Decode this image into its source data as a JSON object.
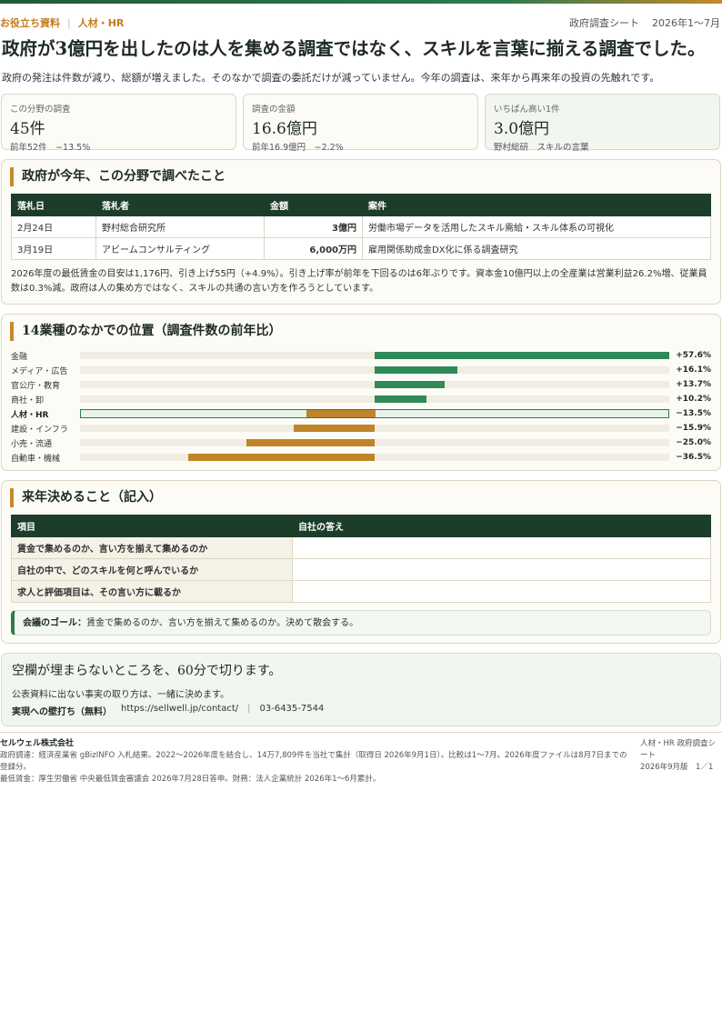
{
  "header": {
    "tag1": "お役立ち資料",
    "tag_sep": "|",
    "tag2": "人材・HR",
    "sheet_type": "政府調査シート",
    "period": "2026年1〜7月"
  },
  "headline": "政府が3億円を出したのは人を集める調査ではなく、スキルを言葉に揃える調査でした。",
  "lede": "政府の発注は件数が減り、総額が増えました。そのなかで調査の委託だけが減っていません。今年の調査は、来年から再来年の投資の先触れです。",
  "kpis": [
    {
      "label": "この分野の調査",
      "value": "45件",
      "sub": "前年52件　−13.5%"
    },
    {
      "label": "調査の金額",
      "value": "16.6億円",
      "sub": "前年16.9億円　−2.2%"
    },
    {
      "label": "いちばん高い1件",
      "value": "3.0億円",
      "sub": "野村総研　スキルの言葉"
    }
  ],
  "contracts": {
    "title": "政府が今年、この分野で調べたこと",
    "columns": [
      "落札日",
      "落札者",
      "金額",
      "案件"
    ],
    "rows": [
      {
        "date": "2月24日",
        "winner": "野村総合研究所",
        "amount": "3億円",
        "subject": "労働市場データを活用したスキル需給・スキル体系の可視化"
      },
      {
        "date": "3月19日",
        "winner": "アビームコンサルティング",
        "amount": "6,000万円",
        "subject": "雇用関係助成金DX化に係る調査研究"
      }
    ],
    "note": "2026年度の最低賃金の目安は1,176円、引き上げ55円（+4.9%）。引き上げ率が前年を下回るのは6年ぶりです。資本金10億円以上の全産業は営業利益26.2%増、従業員数は0.3%減。政府は人の集め方ではなく、スキルの共通の言い方を作ろうとしています。"
  },
  "chart_data": {
    "type": "bar",
    "title": "14業種のなかでの位置（調査件数の前年比）",
    "orientation": "horizontal",
    "categories": [
      "金融",
      "メディア・広告",
      "官公庁・教育",
      "商社・卸",
      "人材・HR",
      "建設・インフラ",
      "小売・流通",
      "自動車・機械"
    ],
    "values": [
      57.6,
      16.1,
      13.7,
      10.2,
      -13.5,
      -15.9,
      -25.0,
      -36.5
    ],
    "value_labels": [
      "+57.6%",
      "+16.1%",
      "+13.7%",
      "+10.2%",
      "−13.5%",
      "−15.9%",
      "−25.0%",
      "−36.5%"
    ],
    "highlight": "人材・HR",
    "colors": {
      "positive": "#2f8a58",
      "negative": "#c0842a"
    },
    "xlim": [
      -57.6,
      57.6
    ]
  },
  "decisions": {
    "title": "来年決めること（記入）",
    "columns": [
      "項目",
      "自社の答え"
    ],
    "rows": [
      {
        "item": "賃金で集めるのか、言い方を揃えて集めるのか",
        "answer": ""
      },
      {
        "item": "自社の中で、どのスキルを何と呼んでいるか",
        "answer": ""
      },
      {
        "item": "求人と評価項目は、その言い方に載るか",
        "answer": ""
      }
    ],
    "goal_label": "会議のゴール：",
    "goal_text": "賃金で集めるのか、言い方を揃えて集めるのか。決めて散会する。"
  },
  "cta": {
    "title": "空欄が埋まらないところを、60分で切ります。",
    "text": "公表資料に出ない事実の取り方は、一緒に決めます。",
    "link_label": "実現への壁打ち（無料）",
    "url": "https://sellwell.jp/contact/",
    "pipe": "|",
    "phone": "03-6435-7544"
  },
  "footer": {
    "company": "セルウェル株式会社",
    "source1": "政府調達：経済産業省 gBizINFO 入札結果。2022〜2026年度を結合し、14万7,809件を当社で集計（取得日 2026年9月1日）。比較は1〜7月。2026年度ファイルは8月7日までの登録分。",
    "source2": "最低賃金：厚生労働省 中央最低賃金審議会 2026年7月28日答申。財務：法人企業統計 2026年1〜6月累計。",
    "doc_name": "人材・HR 政府調査シート",
    "edition": "2026年9月版　1／1"
  }
}
